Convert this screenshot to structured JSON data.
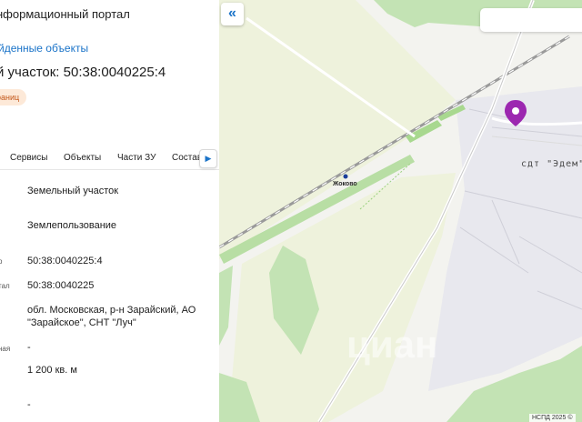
{
  "panel": {
    "portal_title": "нформационный портал",
    "back_link": "йденные объекты",
    "parcel_title": "й участок: 50:38:0040225:4",
    "badge": "раниц",
    "tabs": [
      "Сервисы",
      "Объекты",
      "Части ЗУ",
      "Состав"
    ],
    "tab_scroll_icon": "chevron-right-icon",
    "fields": [
      {
        "label": "",
        "value": "Земельный участок"
      },
      {
        "label": "",
        "value": "Землепользование"
      },
      {
        "label": "р",
        "value": "50:38:0040225:4"
      },
      {
        "label": "тал",
        "value": "50:38:0040225"
      },
      {
        "label": "",
        "value": "обл. Московская, р-н Зарайский, АО \"Зарайское\", СНТ \"Луч\""
      },
      {
        "label": "ная",
        "value": "-"
      },
      {
        "label": "",
        "value": "1 200 кв. м"
      },
      {
        "label": "",
        "value": "-"
      }
    ]
  },
  "map": {
    "collapse_icon": "double-chevron-left-icon",
    "collapse_symbol": "«",
    "station_label": "Жоково",
    "snt_label": "сдт \"Эдем\"",
    "watermark": "циан",
    "copyright": "НСПД 2025 ©",
    "marker_color": "#9c27b0",
    "forest_color": "#c3e3b4",
    "field_color": "#eef2dc"
  }
}
